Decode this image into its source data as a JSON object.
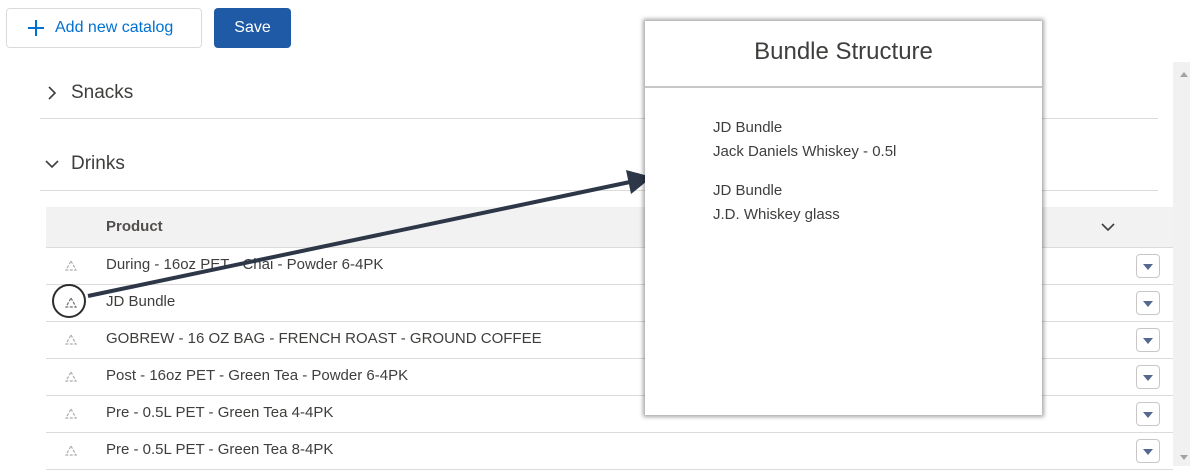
{
  "toolbar": {
    "add_catalog_label": "Add new catalog",
    "save_label": "Save"
  },
  "sections": [
    {
      "title": "Snacks",
      "expanded": false
    },
    {
      "title": "Drinks",
      "expanded": true
    }
  ],
  "table": {
    "column_header": "Product",
    "rows": [
      {
        "product": "During - 16oz PET - Chai - Powder 6-4PK"
      },
      {
        "product": "JD Bundle"
      },
      {
        "product": "GOBREW - 16 OZ BAG - FRENCH ROAST - GROUND COFFEE"
      },
      {
        "product": "Post - 16oz PET - Green Tea - Powder 6-4PK"
      },
      {
        "product": "Pre - 0.5L PET - Green Tea 4-4PK"
      },
      {
        "product": "Pre - 0.5L PET - Green Tea 8-4PK"
      }
    ]
  },
  "popup": {
    "title": "Bundle Structure",
    "entries": [
      {
        "bundle": "JD Bundle",
        "item": "Jack Daniels Whiskey - 0.5l"
      },
      {
        "bundle": "JD Bundle",
        "item": "J.D. Whiskey glass"
      }
    ]
  },
  "colors": {
    "brand_blue": "#1f5aa6",
    "link_blue": "#0070d2",
    "annotation_dark": "#2d3748"
  },
  "icons": {
    "add": "plus-icon",
    "collapsed": "chevron-right-icon",
    "expanded": "chevron-down-icon",
    "row_type": "recycle-icon",
    "row_menu": "dropdown-triangle-icon"
  }
}
